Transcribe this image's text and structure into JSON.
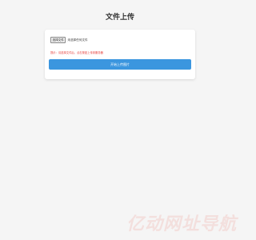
{
  "page": {
    "title": "文件上传"
  },
  "uploader": {
    "choose_button_label": "选择文件",
    "file_status": "未选择任何文件",
    "hint": "提示：请选择文件后，点击按钮上传到服务器",
    "submit_label": "开始上传图片"
  },
  "watermark": {
    "text": "亿动网址导航"
  },
  "colors": {
    "accent": "#3b96df",
    "hint_text": "#e53935",
    "background": "#f5f5f5",
    "watermark": "#e74c3c"
  }
}
